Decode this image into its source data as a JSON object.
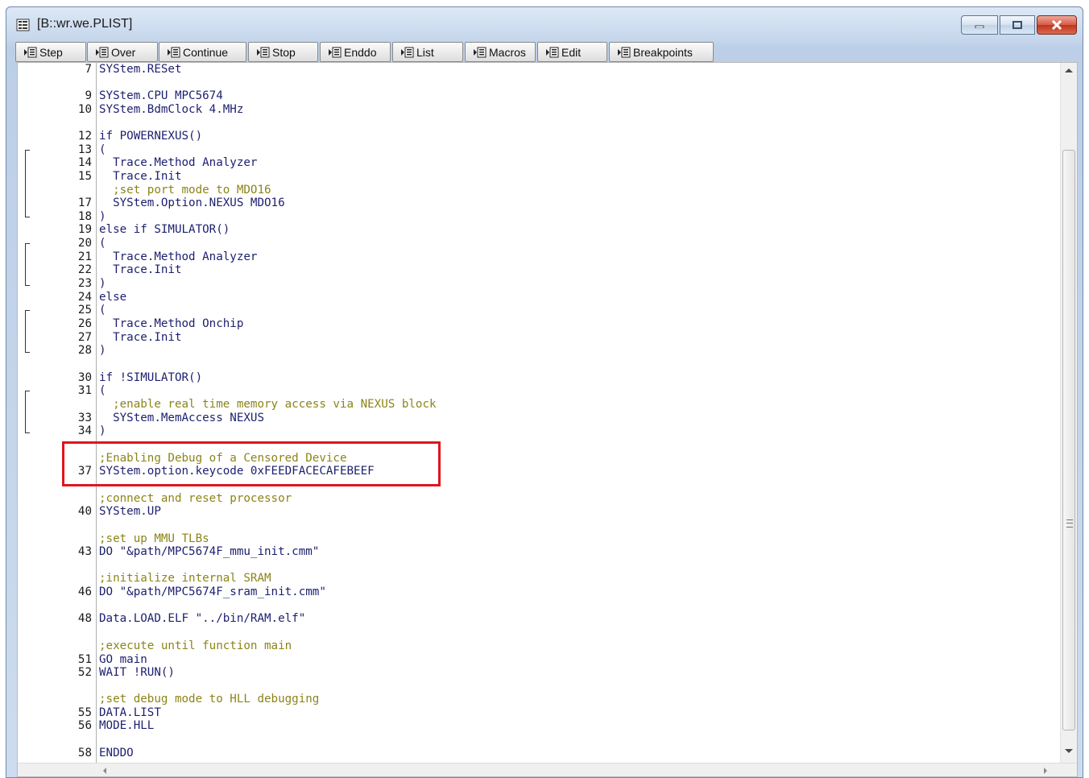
{
  "window": {
    "title": "[B::wr.we.PLIST]"
  },
  "toolbar": {
    "buttons": [
      {
        "label": "Step",
        "name": "step-button",
        "icon": "step-icon"
      },
      {
        "label": "Over",
        "name": "over-button",
        "icon": "step-over-icon"
      },
      {
        "label": "Continue",
        "name": "continue-button",
        "icon": "continue-icon"
      },
      {
        "label": "Stop",
        "name": "stop-button",
        "icon": "stop-icon"
      },
      {
        "label": "Enddo",
        "name": "enddo-button",
        "icon": "enddo-icon"
      },
      {
        "label": "List",
        "name": "list-button",
        "icon": "list-icon"
      },
      {
        "label": "Macros",
        "name": "macros-button",
        "icon": "macros-icon"
      },
      {
        "label": "Edit",
        "name": "edit-button",
        "icon": "edit-icon"
      },
      {
        "label": "Breakpoints",
        "name": "breakpoints-button",
        "icon": "breakpoints-icon"
      }
    ]
  },
  "code": {
    "lines": [
      {
        "num": "7",
        "text": "SYStem.RESet",
        "kind": "code"
      },
      {
        "num": "9",
        "text": "SYStem.CPU MPC5674",
        "kind": "code"
      },
      {
        "num": "10",
        "text": "SYStem.BdmClock 4.MHz",
        "kind": "code"
      },
      {
        "num": "12",
        "text": "if POWERNEXUS()",
        "kind": "code"
      },
      {
        "num": "13",
        "text": "(",
        "kind": "code"
      },
      {
        "num": "14",
        "text": "  Trace.Method Analyzer",
        "kind": "code"
      },
      {
        "num": "15",
        "text": "  Trace.Init",
        "kind": "code"
      },
      {
        "num": "",
        "text": "  ;set port mode to MDO16",
        "kind": "comment"
      },
      {
        "num": "17",
        "text": "  SYStem.Option.NEXUS MDO16",
        "kind": "code"
      },
      {
        "num": "18",
        "text": ")",
        "kind": "code"
      },
      {
        "num": "19",
        "text": "else if SIMULATOR()",
        "kind": "code"
      },
      {
        "num": "20",
        "text": "(",
        "kind": "code"
      },
      {
        "num": "21",
        "text": "  Trace.Method Analyzer",
        "kind": "code"
      },
      {
        "num": "22",
        "text": "  Trace.Init",
        "kind": "code"
      },
      {
        "num": "23",
        "text": ")",
        "kind": "code"
      },
      {
        "num": "24",
        "text": "else",
        "kind": "code"
      },
      {
        "num": "25",
        "text": "(",
        "kind": "code"
      },
      {
        "num": "26",
        "text": "  Trace.Method Onchip",
        "kind": "code"
      },
      {
        "num": "27",
        "text": "  Trace.Init",
        "kind": "code"
      },
      {
        "num": "28",
        "text": ")",
        "kind": "code"
      },
      {
        "num": "30",
        "text": "if !SIMULATOR()",
        "kind": "code"
      },
      {
        "num": "31",
        "text": "(",
        "kind": "code"
      },
      {
        "num": "",
        "text": "  ;enable real time memory access via NEXUS block",
        "kind": "comment"
      },
      {
        "num": "33",
        "text": "  SYStem.MemAccess NEXUS",
        "kind": "code"
      },
      {
        "num": "34",
        "text": ")",
        "kind": "code"
      },
      {
        "num": "",
        "text": ";Enabling Debug of a Censored Device",
        "kind": "comment"
      },
      {
        "num": "37",
        "text": "SYStem.option.keycode 0xFEEDFACECAFEBEEF",
        "kind": "code"
      },
      {
        "num": "",
        "text": ";connect and reset processor",
        "kind": "comment"
      },
      {
        "num": "40",
        "text": "SYStem.UP",
        "kind": "code"
      },
      {
        "num": "",
        "text": ";set up MMU TLBs",
        "kind": "comment"
      },
      {
        "num": "43",
        "text": "DO \"&path/MPC5674F_mmu_init.cmm\"",
        "kind": "code"
      },
      {
        "num": "",
        "text": ";initialize internal SRAM",
        "kind": "comment"
      },
      {
        "num": "46",
        "text": "DO \"&path/MPC5674F_sram_init.cmm\"",
        "kind": "code"
      },
      {
        "num": "48",
        "text": "Data.LOAD.ELF \"../bin/RAM.elf\"",
        "kind": "code"
      },
      {
        "num": "",
        "text": ";execute until function main",
        "kind": "comment"
      },
      {
        "num": "51",
        "text": "GO main",
        "kind": "code"
      },
      {
        "num": "52",
        "text": "WAIT !RUN()",
        "kind": "code"
      },
      {
        "num": "",
        "text": ";set debug mode to HLL debugging",
        "kind": "comment"
      },
      {
        "num": "55",
        "text": "DATA.LIST",
        "kind": "code"
      },
      {
        "num": "56",
        "text": "MODE.HLL",
        "kind": "code"
      },
      {
        "num": "58",
        "text": "ENDDO",
        "kind": "code"
      }
    ]
  },
  "colors": {
    "code_text": "#1c1f6e",
    "comment_text": "#8c8418",
    "highlight_box": "#e0151f"
  }
}
